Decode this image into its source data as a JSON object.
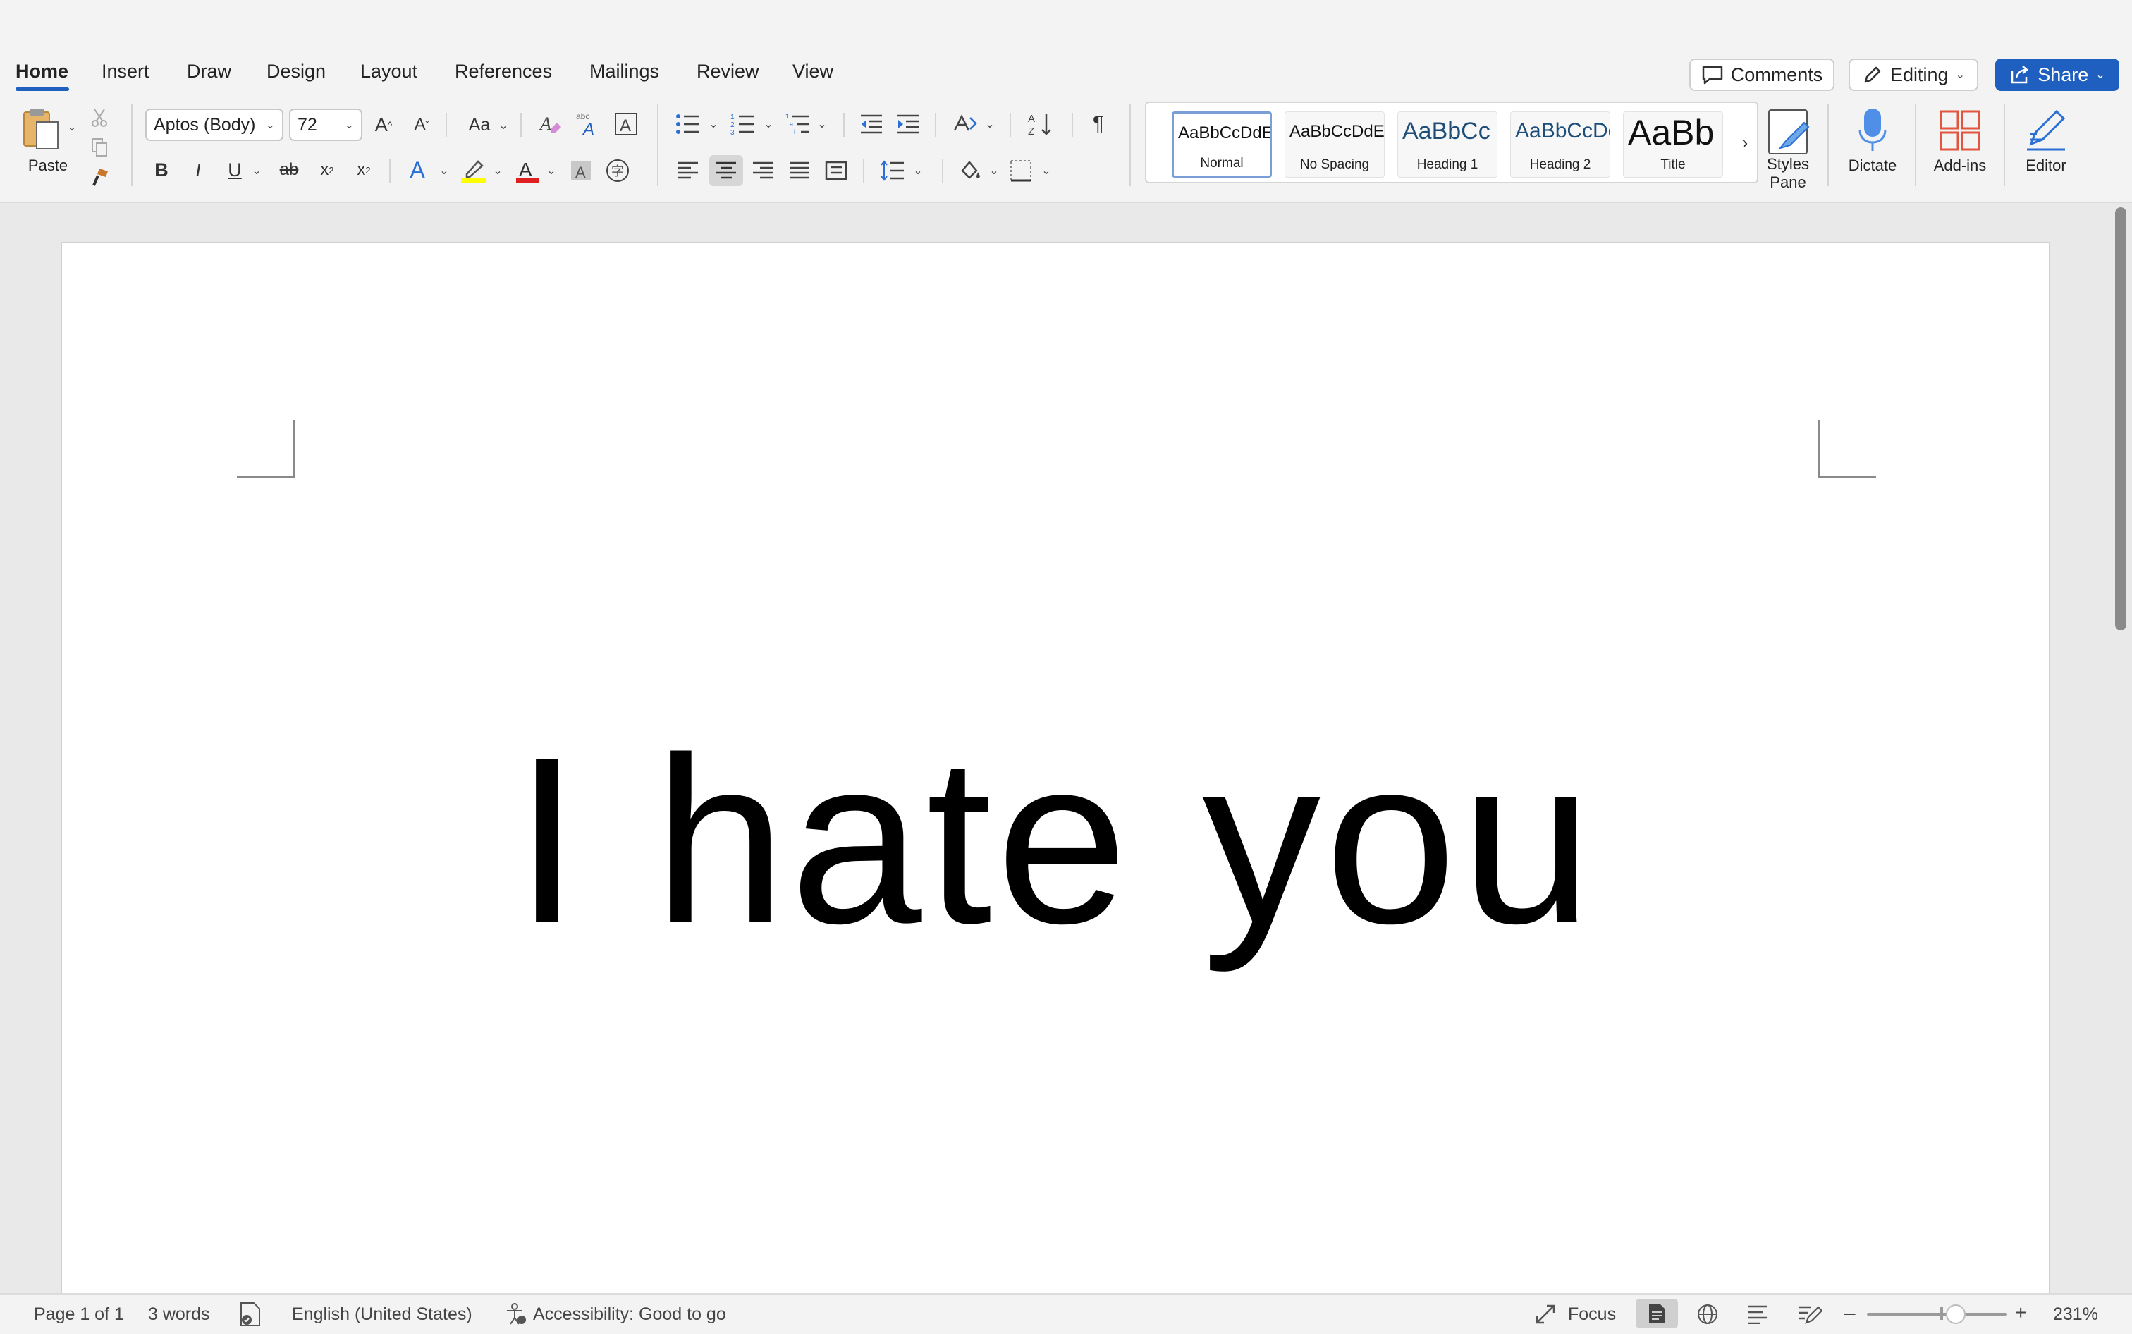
{
  "tabs": [
    {
      "label": "Home"
    },
    {
      "label": "Insert"
    },
    {
      "label": "Draw"
    },
    {
      "label": "Design"
    },
    {
      "label": "Layout"
    },
    {
      "label": "References"
    },
    {
      "label": "Mailings"
    },
    {
      "label": "Review"
    },
    {
      "label": "View"
    }
  ],
  "top_buttons": {
    "comments": "Comments",
    "editing": "Editing",
    "share": "Share"
  },
  "clipboard": {
    "paste_label": "Paste"
  },
  "font": {
    "name": "Aptos (Body)",
    "size": "72",
    "change_case": "Aa"
  },
  "styles": [
    {
      "sample": "AaBbCcDdE",
      "name": "Normal"
    },
    {
      "sample": "AaBbCcDdE",
      "name": "No Spacing"
    },
    {
      "sample": "AaBbCc",
      "name": "Heading 1"
    },
    {
      "sample": "AaBbCcDd",
      "name": "Heading 2"
    },
    {
      "sample": "AaBb",
      "name": "Title"
    }
  ],
  "styles_pane": {
    "line1": "Styles",
    "line2": "Pane"
  },
  "big_buttons": {
    "dictate": "Dictate",
    "addins": "Add-ins",
    "editor": "Editor"
  },
  "document": {
    "text": "I hate you"
  },
  "status": {
    "page": "Page 1 of 1",
    "words": "3 words",
    "language": "English (United States)",
    "accessibility": "Accessibility: Good to go",
    "focus": "Focus",
    "zoom": "231%"
  },
  "colors": {
    "accent": "#1f5fbf",
    "highlight": "#ffff00",
    "font_color": "#e02020"
  }
}
